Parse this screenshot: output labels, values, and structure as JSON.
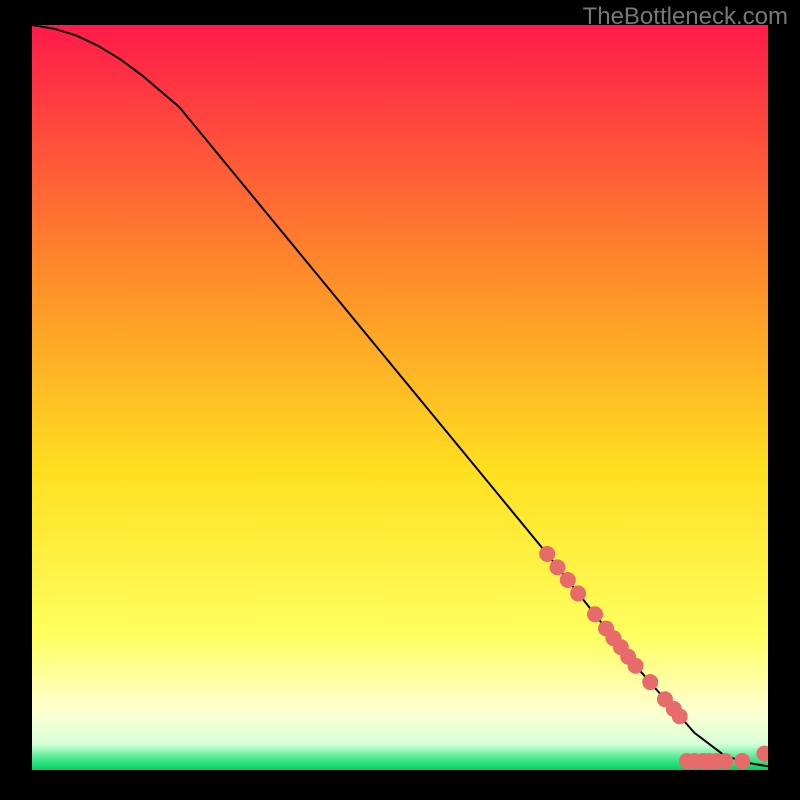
{
  "attribution": "TheBottleneck.com",
  "chart_data": {
    "type": "line",
    "title": "",
    "xlabel": "",
    "ylabel": "",
    "xlim": [
      0,
      100
    ],
    "ylim": [
      0,
      100
    ],
    "background_gradient": {
      "stops": [
        {
          "offset": 0.0,
          "color": "#ff1a4a"
        },
        {
          "offset": 0.33,
          "color": "#ff8a2a"
        },
        {
          "offset": 0.6,
          "color": "#ffe020"
        },
        {
          "offset": 0.82,
          "color": "#ffff60"
        },
        {
          "offset": 0.92,
          "color": "#ffffd0"
        },
        {
          "offset": 0.965,
          "color": "#d8ffd8"
        },
        {
          "offset": 0.985,
          "color": "#48e890"
        },
        {
          "offset": 1.0,
          "color": "#00d060"
        }
      ]
    },
    "series": [
      {
        "name": "bottleneck-curve",
        "stroke": "#000000",
        "x": [
          0,
          3,
          6,
          9,
          12,
          15,
          20,
          30,
          40,
          50,
          60,
          70,
          78,
          82,
          86,
          90,
          94,
          97,
          100
        ],
        "y": [
          100,
          99.5,
          98.6,
          97.2,
          95.4,
          93.2,
          89,
          77,
          65,
          53,
          41,
          29,
          19,
          14,
          9.5,
          5,
          2,
          1,
          0.5
        ]
      }
    ],
    "points": {
      "name": "highlighted-points",
      "color": "#e86b6b",
      "radius": 8,
      "items": [
        {
          "x": 70.0,
          "y": 29.0
        },
        {
          "x": 71.4,
          "y": 27.2
        },
        {
          "x": 72.8,
          "y": 25.5
        },
        {
          "x": 74.2,
          "y": 23.7
        },
        {
          "x": 76.5,
          "y": 20.9
        },
        {
          "x": 78.0,
          "y": 19.0
        },
        {
          "x": 79.0,
          "y": 17.7
        },
        {
          "x": 80.0,
          "y": 16.5
        },
        {
          "x": 81.0,
          "y": 15.2
        },
        {
          "x": 82.0,
          "y": 14.0
        },
        {
          "x": 84.0,
          "y": 11.8
        },
        {
          "x": 86.0,
          "y": 9.5
        },
        {
          "x": 87.2,
          "y": 8.2
        },
        {
          "x": 88.0,
          "y": 7.2
        },
        {
          "x": 89.0,
          "y": 1.2
        },
        {
          "x": 90.0,
          "y": 1.2
        },
        {
          "x": 91.2,
          "y": 1.2
        },
        {
          "x": 92.0,
          "y": 1.2
        },
        {
          "x": 93.0,
          "y": 1.2
        },
        {
          "x": 94.2,
          "y": 1.2
        },
        {
          "x": 96.5,
          "y": 1.2
        },
        {
          "x": 99.5,
          "y": 2.2
        }
      ]
    }
  }
}
